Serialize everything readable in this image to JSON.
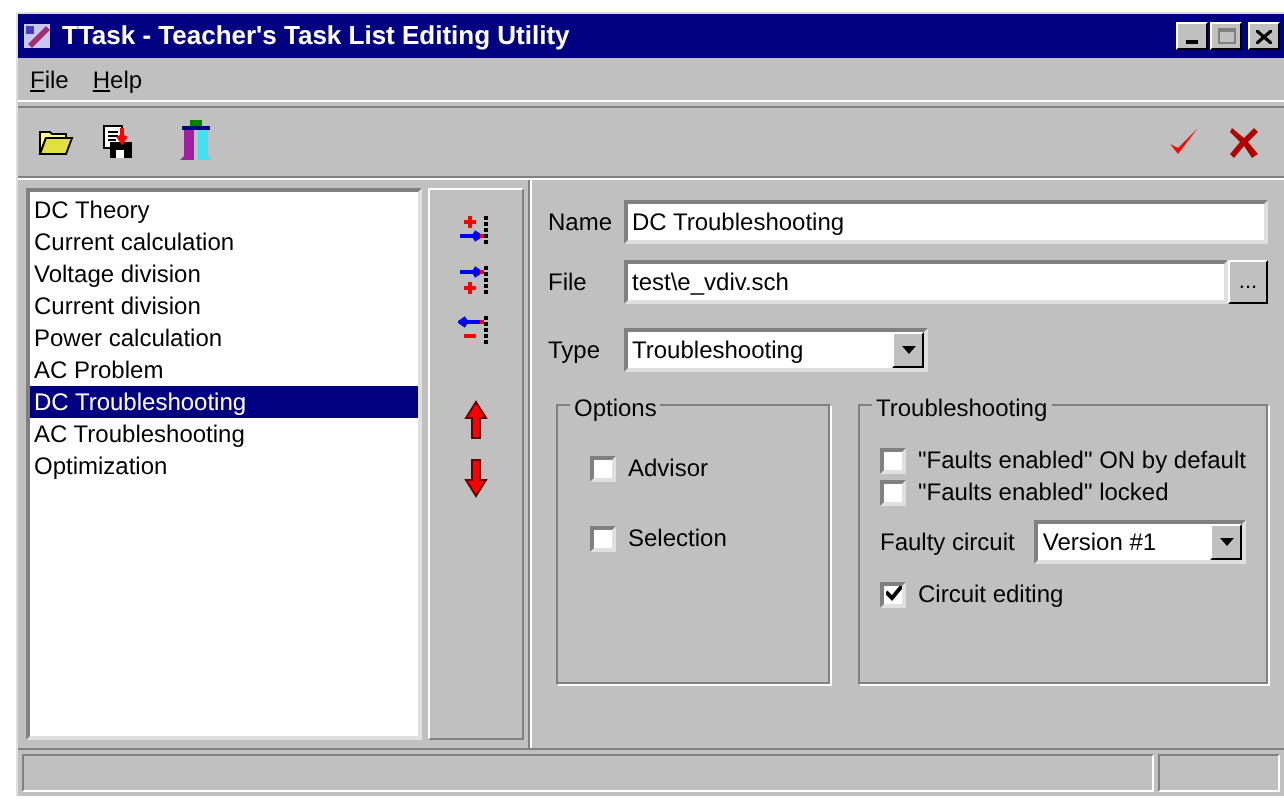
{
  "window": {
    "title": "TTask - Teacher's Task List Editing Utility"
  },
  "menu": [
    {
      "label": "File"
    },
    {
      "label": "Help"
    }
  ],
  "tasks": [
    {
      "label": "DC Theory",
      "selected": false
    },
    {
      "label": "Current calculation",
      "selected": false
    },
    {
      "label": "Voltage division",
      "selected": false
    },
    {
      "label": "Current division",
      "selected": false
    },
    {
      "label": "Power calculation",
      "selected": false
    },
    {
      "label": "AC Problem",
      "selected": false
    },
    {
      "label": "DC Troubleshooting",
      "selected": true
    },
    {
      "label": "AC Troubleshooting",
      "selected": false
    },
    {
      "label": "Optimization",
      "selected": false
    }
  ],
  "form": {
    "name_label": "Name",
    "name": "DC Troubleshooting",
    "file_label": "File",
    "file": "test\\e_vdiv.sch",
    "browse": "...",
    "type_label": "Type",
    "type": "Troubleshooting"
  },
  "options": {
    "title": "Options",
    "items": [
      {
        "label": "Advisor",
        "checked": false
      },
      {
        "label": "Selection",
        "checked": false
      }
    ]
  },
  "troubleshooting": {
    "title": "Troubleshooting",
    "items": [
      {
        "label": "\"Faults enabled\" ON by default",
        "checked": false
      },
      {
        "label": "\"Faults enabled\" locked",
        "checked": false
      }
    ],
    "faulty_label": "Faulty circuit",
    "faulty": "Version #1",
    "editing": {
      "label": "Circuit editing",
      "checked": true
    }
  }
}
